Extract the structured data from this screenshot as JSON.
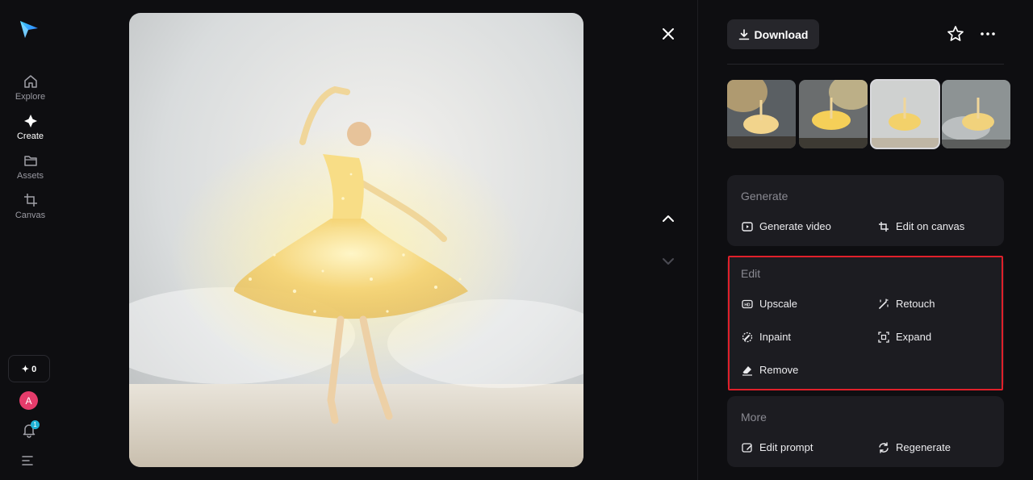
{
  "sidebar": {
    "items": [
      {
        "label": "Explore",
        "icon": "home-icon"
      },
      {
        "label": "Create",
        "icon": "sparkle-icon"
      },
      {
        "label": "Assets",
        "icon": "folder-icon"
      },
      {
        "label": "Canvas",
        "icon": "crop-icon"
      }
    ],
    "credits": "✦ 0",
    "avatar_initial": "A",
    "notification_count": "1"
  },
  "toolbar": {
    "download_label": "Download"
  },
  "panel": {
    "generate": {
      "title": "Generate",
      "actions": [
        {
          "label": "Generate video",
          "icon": "play-icon"
        },
        {
          "label": "Edit on canvas",
          "icon": "crop-icon"
        }
      ]
    },
    "edit": {
      "title": "Edit",
      "actions": [
        {
          "label": "Upscale",
          "icon": "hd-icon"
        },
        {
          "label": "Retouch",
          "icon": "magic-wand-icon"
        },
        {
          "label": "Inpaint",
          "icon": "brush-circle-icon"
        },
        {
          "label": "Expand",
          "icon": "expand-icon"
        },
        {
          "label": "Remove",
          "icon": "eraser-icon"
        }
      ]
    },
    "more": {
      "title": "More",
      "actions": [
        {
          "label": "Edit prompt",
          "icon": "edit-icon"
        },
        {
          "label": "Regenerate",
          "icon": "refresh-icon"
        }
      ]
    }
  },
  "colors": {
    "background": "#0e0e11",
    "card": "#1c1c21",
    "highlight": "#e0202a",
    "accent": "#1fb3d6"
  }
}
